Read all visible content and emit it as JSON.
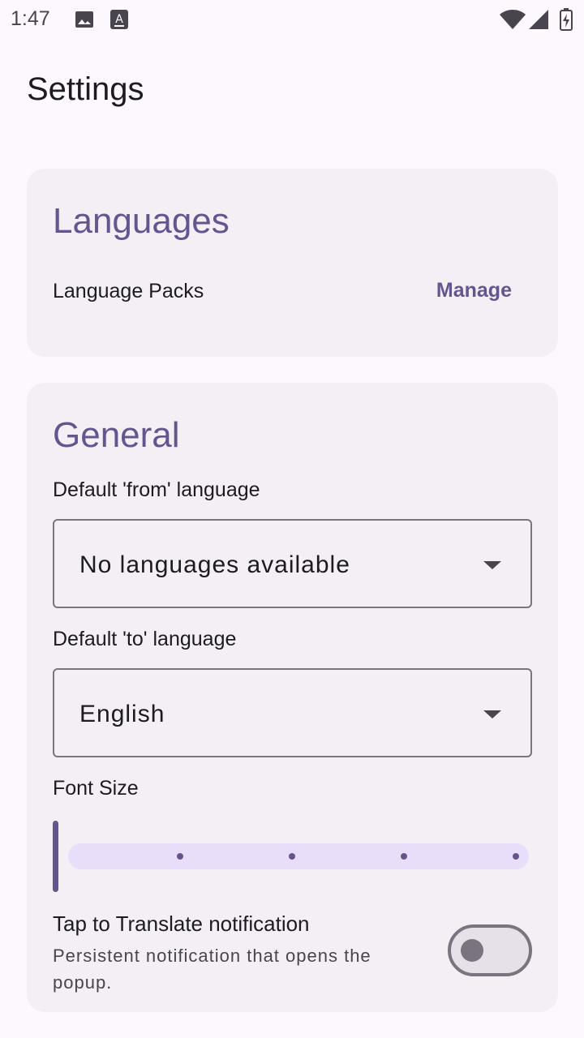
{
  "status_bar": {
    "time": "1:47",
    "icons": [
      "image-icon",
      "keyboard-a-icon",
      "wifi-icon",
      "signal-icon",
      "battery-charging-icon"
    ]
  },
  "page": {
    "title": "Settings"
  },
  "languages_card": {
    "title": "Languages",
    "language_packs_label": "Language Packs",
    "manage_label": "Manage"
  },
  "general_card": {
    "title": "General",
    "from_label": "Default 'from' language",
    "from_value": "No languages available",
    "to_label": "Default 'to' language",
    "to_value": "English",
    "font_size_label": "Font Size",
    "font_size_slider": {
      "value_index": 0,
      "steps": 5
    },
    "tap_title": "Tap to Translate notification",
    "tap_subtitle": "Persistent notification that opens the popup.",
    "tap_enabled": false
  },
  "colors": {
    "accent": "#65558f",
    "background": "#fdf7fe",
    "card": "#f4eff5"
  }
}
